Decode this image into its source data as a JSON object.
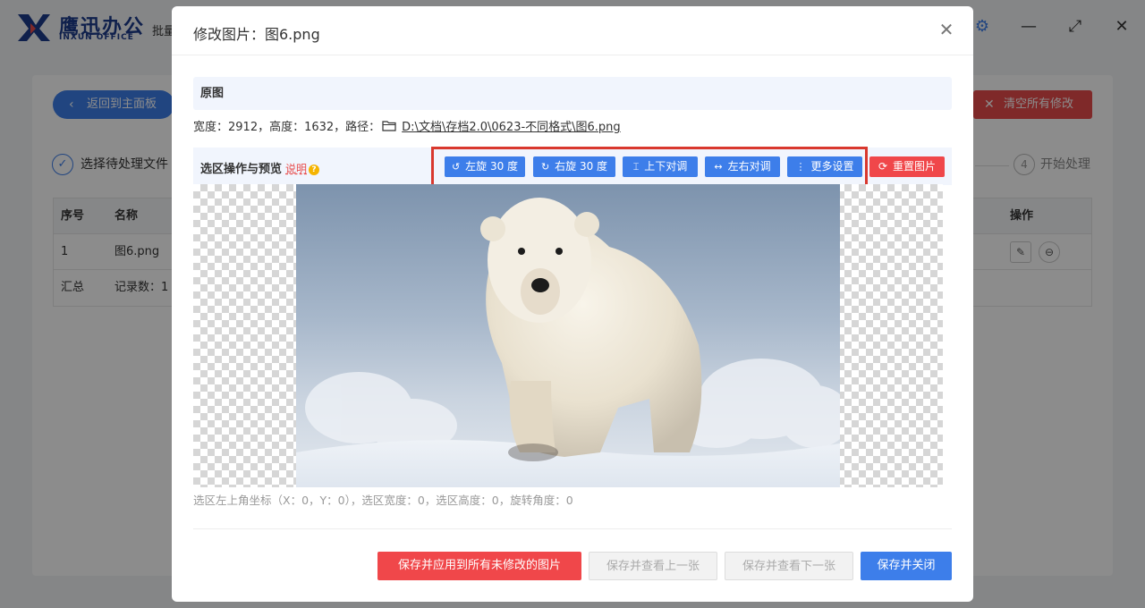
{
  "app": {
    "logo_cn": "鹰迅办公",
    "logo_en": "INXUN OFFICE",
    "title_partial": "批量",
    "back_label": "返回到主面板",
    "clear_label": "清空所有修改",
    "step1_label": "选择待处理文件",
    "step4_num": "4",
    "step4_label": "开始处理",
    "table": {
      "headers": {
        "index": "序号",
        "name": "名称",
        "ops": "操作"
      },
      "rows": [
        {
          "index": "1",
          "name": "图6.png"
        }
      ],
      "summary": {
        "label": "汇总",
        "count": "记录数：1"
      }
    }
  },
  "dialog": {
    "title": "修改图片：图6.png",
    "original_section": "原图",
    "width_text": "宽度：2912，高度：1632，路径：",
    "path": "D:\\文档\\存档2.0\\0623-不同格式\\图6.png",
    "preview_title": "选区操作与预览",
    "help_label": "说明",
    "toolbar": {
      "rotate_left": "左旋 30 度",
      "rotate_right": "右旋 30 度",
      "flip_vertical": "上下对调",
      "flip_horizontal": "左右对调",
      "more_settings": "更多设置",
      "reset": "重置图片"
    },
    "coords_text": "选区左上角坐标（X：0，Y：0），选区宽度：0，选区高度：0，旋转角度：0",
    "footer": {
      "apply_all": "保存并应用到所有未修改的图片",
      "prev": "保存并查看上一张",
      "next": "保存并查看下一张",
      "save_close": "保存并关闭"
    }
  },
  "colors": {
    "primary": "#3d7eea",
    "danger": "#f0474a",
    "highlight_border": "#d9382e"
  }
}
